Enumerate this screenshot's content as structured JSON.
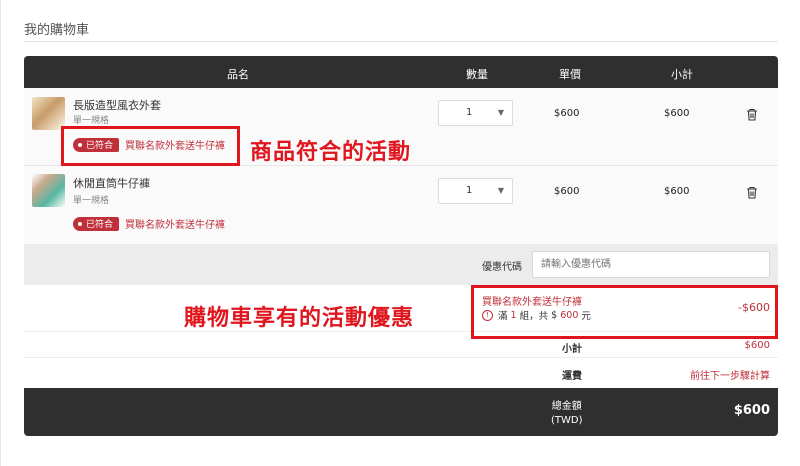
{
  "page": {
    "title": "我的購物車"
  },
  "table_header": {
    "product": "品名",
    "quantity": "數量",
    "unit_price": "單價",
    "subtotal": "小計"
  },
  "items": [
    {
      "name": "長版造型風衣外套",
      "spec": "單一規格",
      "quantity": "1",
      "price": "$600",
      "subtotal": "$600",
      "promo_badge": "已符合",
      "promo_text": "買聯名款外套送牛仔褲",
      "thumb_icon": "coat-photo"
    },
    {
      "name": "休閒直筒牛仔褲",
      "spec": "單一規格",
      "quantity": "1",
      "price": "$600",
      "subtotal": "$600",
      "promo_badge": "已符合",
      "promo_text": "買聯名款外套送牛仔褲",
      "thumb_icon": "jeans-photo"
    }
  ],
  "coupon": {
    "label": "優惠代碼",
    "placeholder": "請輸入優惠代碼",
    "value": ""
  },
  "promotion": {
    "name": "買聯名款外套送牛仔褲",
    "detail_prefix": "滿",
    "detail_count": "1",
    "detail_mid": "組，共",
    "detail_amount_prefix": "$",
    "detail_amount": "600",
    "detail_suffix": "元",
    "discount": "-$600"
  },
  "summary": {
    "subtotal_label": "小計",
    "subtotal_value": "$600",
    "shipping_label": "運費",
    "shipping_value": "前往下一步驟計算",
    "total_label_line1": "總金額",
    "total_label_line2": "(TWD)",
    "total_value": "$600"
  },
  "annotations": {
    "product_promo": "商品符合的活動",
    "cart_promo": "購物車享有的活動優惠"
  },
  "colors": {
    "accent": "#c0303b",
    "annotation": "#e0161e",
    "header_bg": "#2f2f2f"
  }
}
